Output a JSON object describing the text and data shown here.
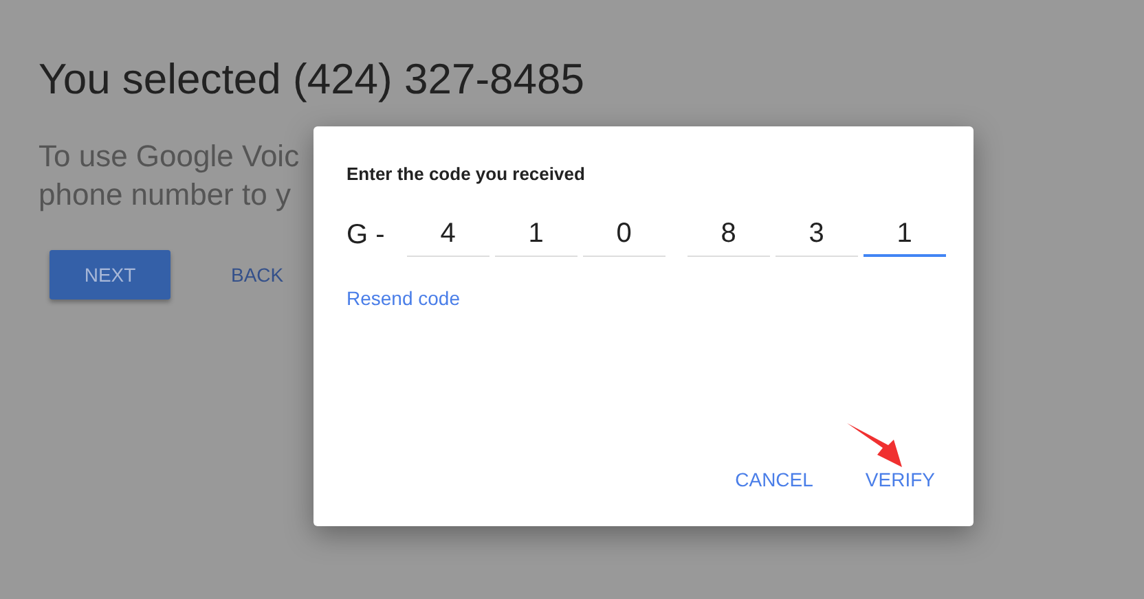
{
  "page": {
    "title": "You selected (424) 327-8485",
    "description_lines": [
      "To use Google Voic",
      "phone number to y"
    ],
    "buttons": [
      {
        "label": "NEXT",
        "kind": "primary"
      },
      {
        "label": "BACK",
        "kind": "flat"
      }
    ]
  },
  "dialog": {
    "heading": "Enter the code you received",
    "prefix": "G -",
    "code_groups": [
      {
        "digits": [
          {
            "value": "4",
            "focused": false
          },
          {
            "value": "1",
            "focused": false
          },
          {
            "value": "0",
            "focused": false
          }
        ]
      },
      {
        "digits": [
          {
            "value": "8",
            "focused": false
          },
          {
            "value": "3",
            "focused": false
          },
          {
            "value": "1",
            "focused": true
          }
        ]
      }
    ],
    "resend_link": "Resend code",
    "actions": [
      "CANCEL",
      "VERIFY"
    ]
  }
}
